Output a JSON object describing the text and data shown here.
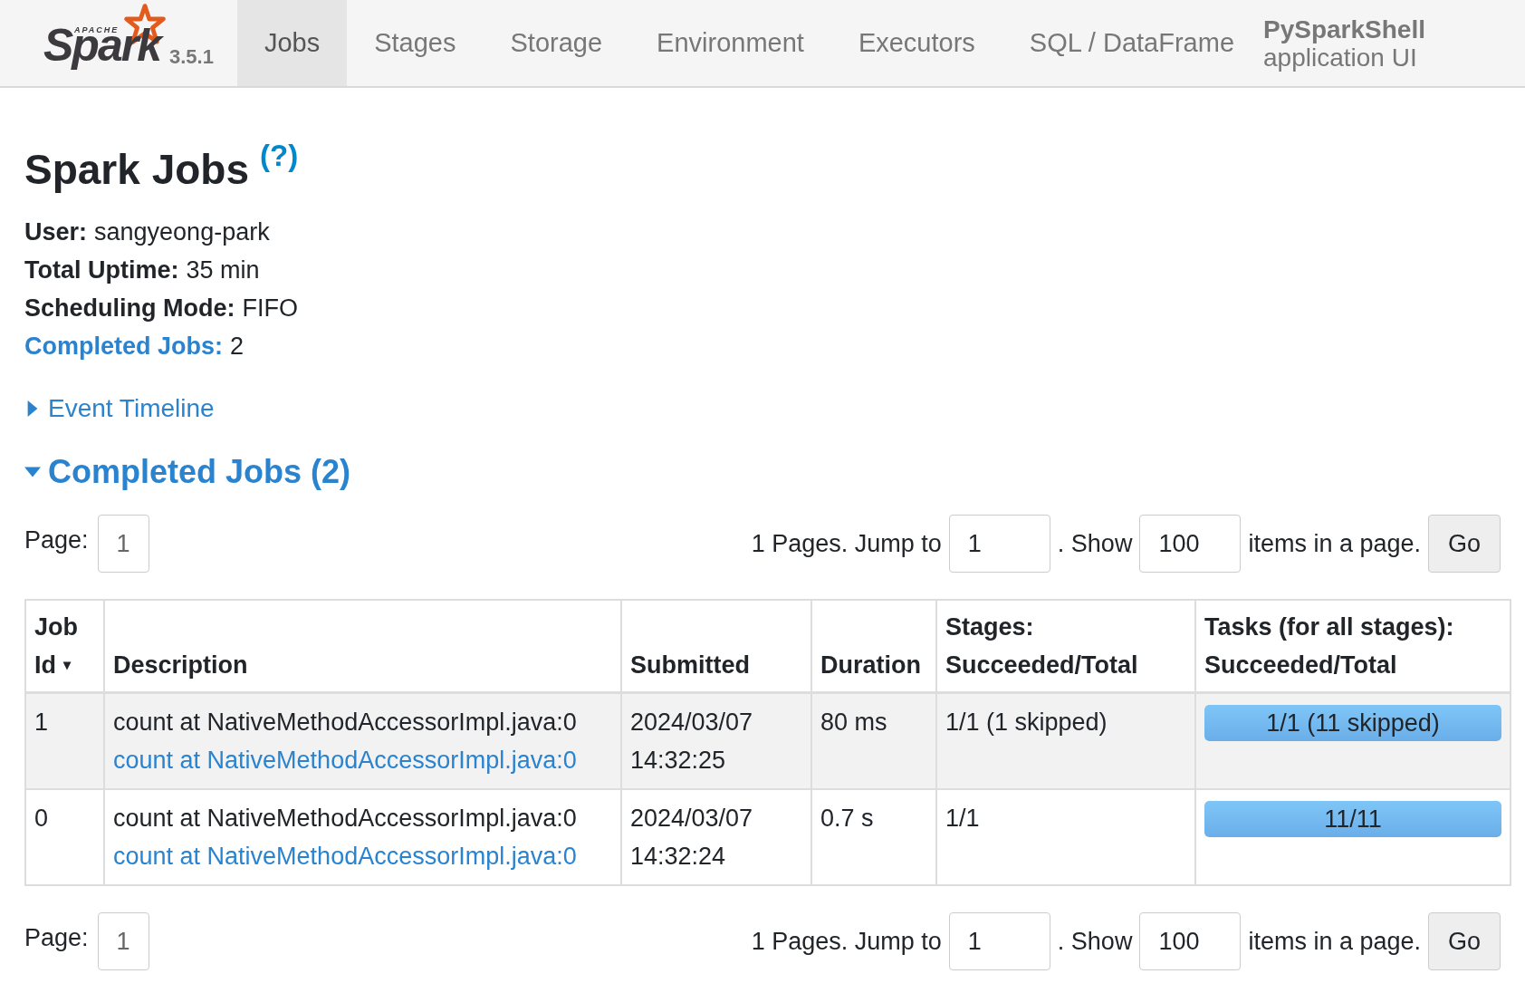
{
  "navbar": {
    "logo": {
      "top": "APACHE",
      "word": "Spark"
    },
    "version": "3.5.1",
    "tabs": [
      {
        "label": "Jobs",
        "selected": true
      },
      {
        "label": "Stages",
        "selected": false
      },
      {
        "label": "Storage",
        "selected": false
      },
      {
        "label": "Environment",
        "selected": false
      },
      {
        "label": "Executors",
        "selected": false
      },
      {
        "label": "SQL / DataFrame",
        "selected": false
      }
    ],
    "app_name": "PySparkShell",
    "app_suffix": "application UI"
  },
  "title": "Spark Jobs",
  "help": "(?)",
  "summary": [
    {
      "label": "User:",
      "value": "sangyeong-park",
      "link": false
    },
    {
      "label": "Total Uptime:",
      "value": "35 min",
      "link": false
    },
    {
      "label": "Scheduling Mode:",
      "value": "FIFO",
      "link": false
    },
    {
      "label": "Completed Jobs:",
      "value": "2",
      "link": true
    }
  ],
  "timeline": {
    "label": "Event Timeline",
    "expanded": false
  },
  "section": {
    "label": "Completed Jobs (2)",
    "expanded": true
  },
  "pagination_top": {
    "page_label": "Page:",
    "page": "1",
    "pages_text": "1 Pages. Jump to",
    "jump": "1",
    "show_text": ". Show",
    "show": "100",
    "items_text": "items in a page.",
    "go": "Go"
  },
  "table": {
    "columns": [
      {
        "lines": [
          "Job",
          "Id"
        ],
        "sort": "▾"
      },
      {
        "lines": [
          "Description"
        ]
      },
      {
        "lines": [
          "Submitted"
        ]
      },
      {
        "lines": [
          "Duration"
        ]
      },
      {
        "lines": [
          "Stages:",
          "Succeeded/Total"
        ]
      },
      {
        "lines": [
          "Tasks (for all stages):",
          "Succeeded/Total"
        ]
      }
    ],
    "rows": [
      {
        "id": "1",
        "desc": "count at NativeMethodAccessorImpl.java:0",
        "desc_link": "count at NativeMethodAccessorImpl.java:0",
        "submitted": [
          "2024/03/07",
          "14:32:25"
        ],
        "duration": "80 ms",
        "stages": "1/1 (1 skipped)",
        "tasks": {
          "text": "1/1 (11 skipped)",
          "level": 1
        }
      },
      {
        "id": "0",
        "desc": "count at NativeMethodAccessorImpl.java:0",
        "desc_link": "count at NativeMethodAccessorImpl.java:0",
        "submitted": [
          "2024/03/07",
          "14:32:24"
        ],
        "duration": "0.7 s",
        "stages": "1/1",
        "tasks": {
          "text": "11/11",
          "level": 1
        }
      }
    ]
  },
  "pagination_bottom": {
    "page_label": "Page:",
    "page": "1",
    "pages_text": "1 Pages. Jump to",
    "jump": "1",
    "show_text": ". Show",
    "show": "100",
    "items_text": "items in a page.",
    "go": "Go"
  }
}
